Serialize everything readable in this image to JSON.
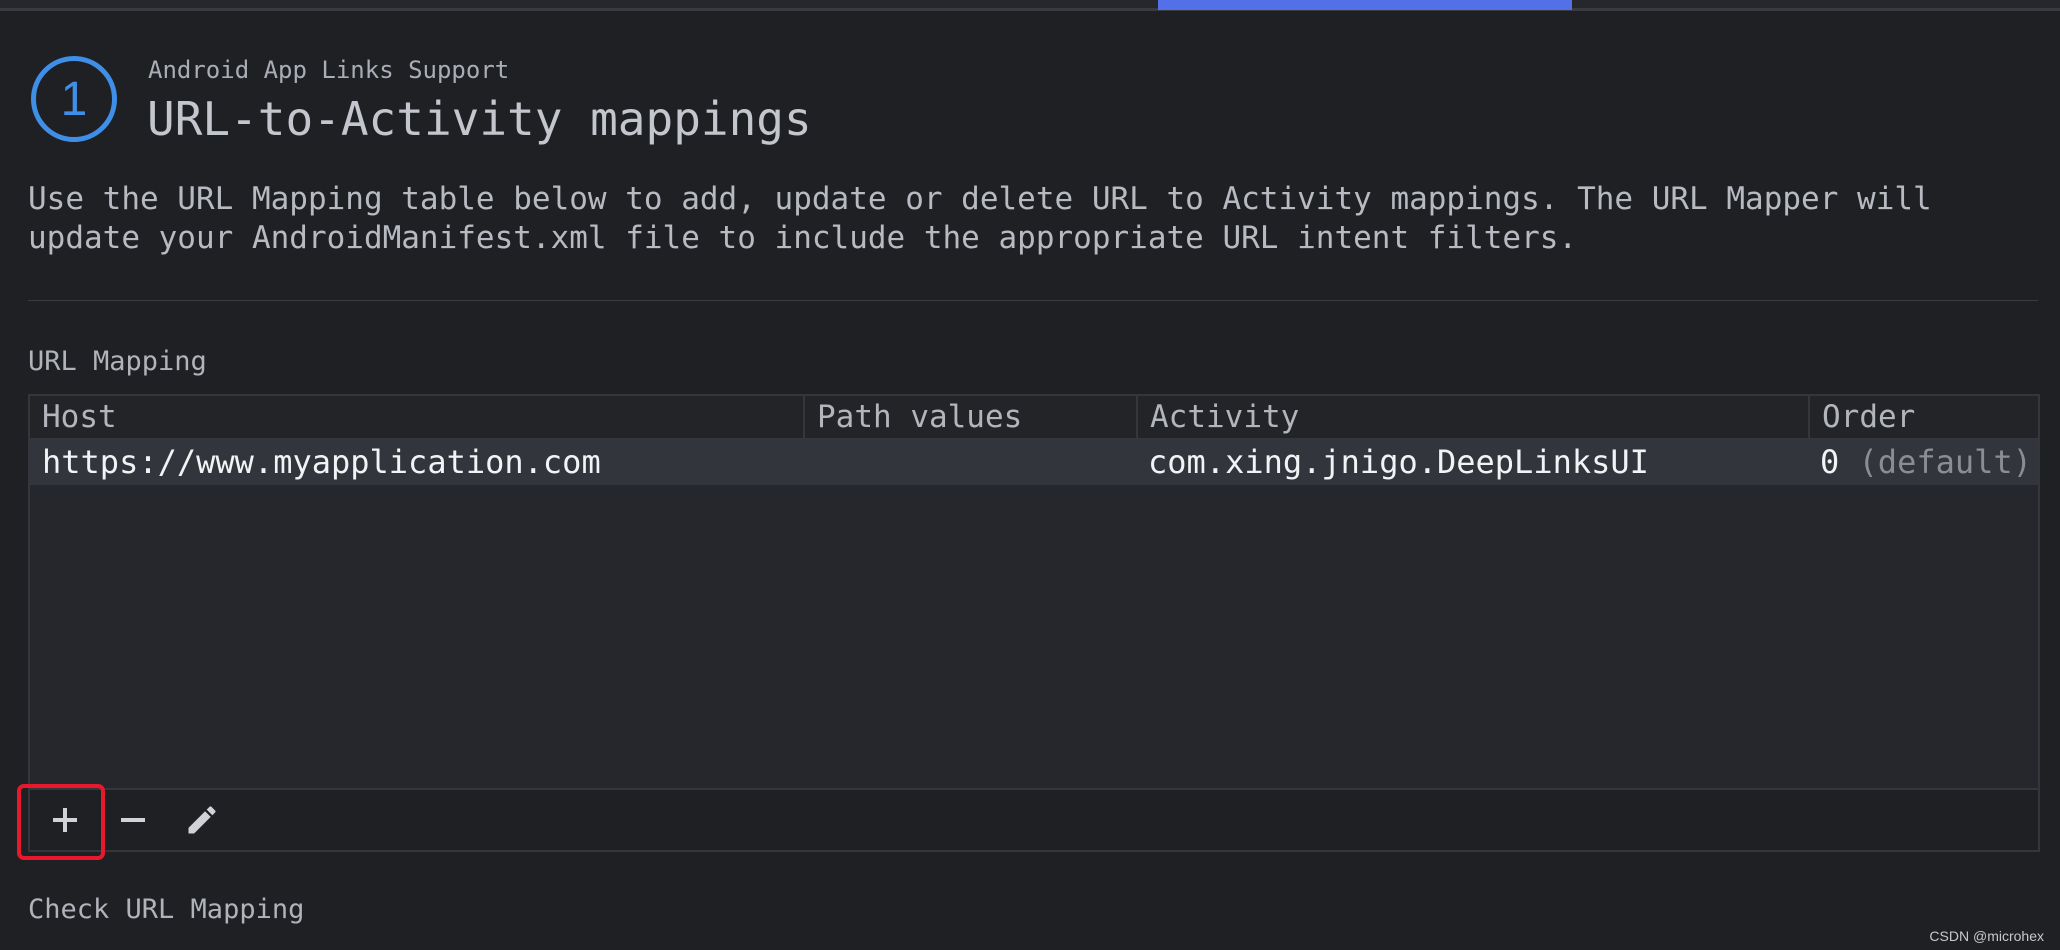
{
  "header": {
    "step_number": "1",
    "subtitle": "Android App Links Support",
    "title": "URL-to-Activity mappings",
    "description": "Use the URL Mapping table below to add, update or delete URL to Activity mappings. The URL Mapper will\nupdate your AndroidManifest.xml file to include the appropriate URL intent filters."
  },
  "url_mapping": {
    "label": "URL Mapping",
    "columns": [
      "Host",
      "Path values",
      "Activity",
      "Order"
    ],
    "rows": [
      {
        "host": "https://www.myapplication.com",
        "path_values": "",
        "activity": "com.xing.jnigo.DeepLinksUI",
        "order": "0",
        "order_hint": "(default)"
      }
    ],
    "toolbar": {
      "add_icon": "plus-icon",
      "remove_icon": "minus-icon",
      "edit_icon": "pencil-icon"
    }
  },
  "check_section": {
    "label": "Check URL Mapping"
  },
  "watermark": "CSDN @microhex",
  "colors": {
    "background": "#1f2024",
    "accent": "#3f8fe8",
    "active_tab": "#5470e8",
    "highlight": "#e8192c"
  }
}
